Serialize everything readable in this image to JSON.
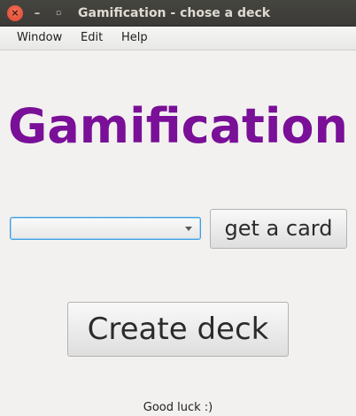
{
  "window": {
    "title": "Gamification - chose a deck",
    "close_glyph": "×",
    "minimize_glyph": "–",
    "maximize_glyph": "▫"
  },
  "menu": {
    "items": [
      {
        "label": "Window"
      },
      {
        "label": "Edit"
      },
      {
        "label": "Help"
      }
    ]
  },
  "main": {
    "heading": "Gamification",
    "heading_color": "#7a0f98",
    "deck_select": {
      "value": "",
      "icon": "chevron-down-icon"
    },
    "get_card_label": "get a card",
    "create_deck_label": "Create deck"
  },
  "status": {
    "text": "Good luck :)"
  }
}
